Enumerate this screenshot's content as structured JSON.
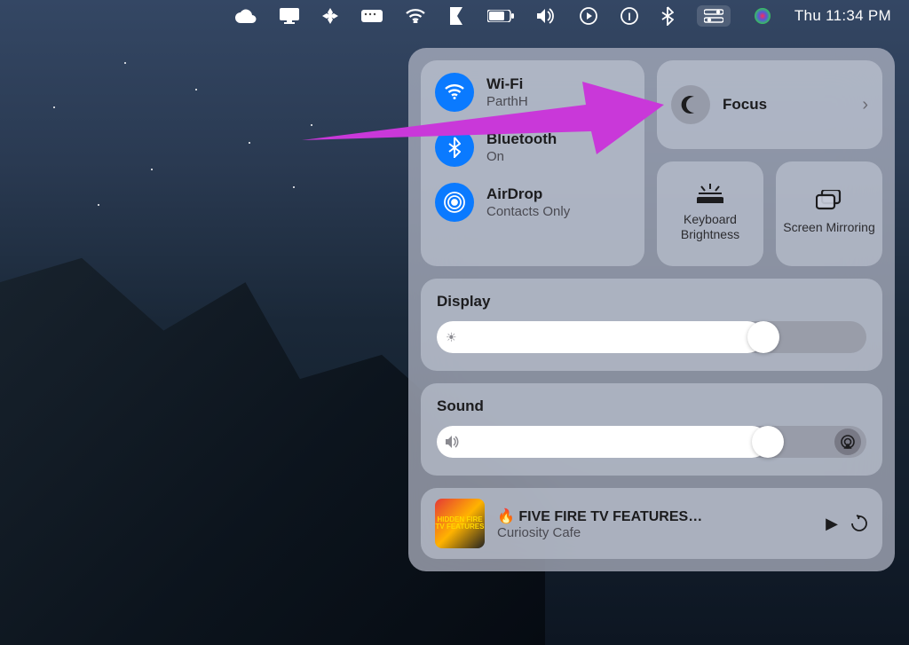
{
  "menubar": {
    "datetime": "Thu 11:34 PM"
  },
  "controlCenter": {
    "wifi": {
      "title": "Wi-Fi",
      "sub": "ParthH"
    },
    "bluetooth": {
      "title": "Bluetooth",
      "sub": "On"
    },
    "airdrop": {
      "title": "AirDrop",
      "sub": "Contacts Only"
    },
    "focus": {
      "title": "Focus"
    },
    "keyboardBrightness": {
      "label": "Keyboard Brightness"
    },
    "screenMirroring": {
      "label": "Screen Mirroring"
    },
    "display": {
      "title": "Display",
      "value": 76
    },
    "sound": {
      "title": "Sound",
      "value": 77
    },
    "media": {
      "title": "🔥 FIVE FIRE TV FEATURES…",
      "artist": "Curiosity Cafe",
      "artText": "HIDDEN FIRE TV FEATURES"
    }
  }
}
